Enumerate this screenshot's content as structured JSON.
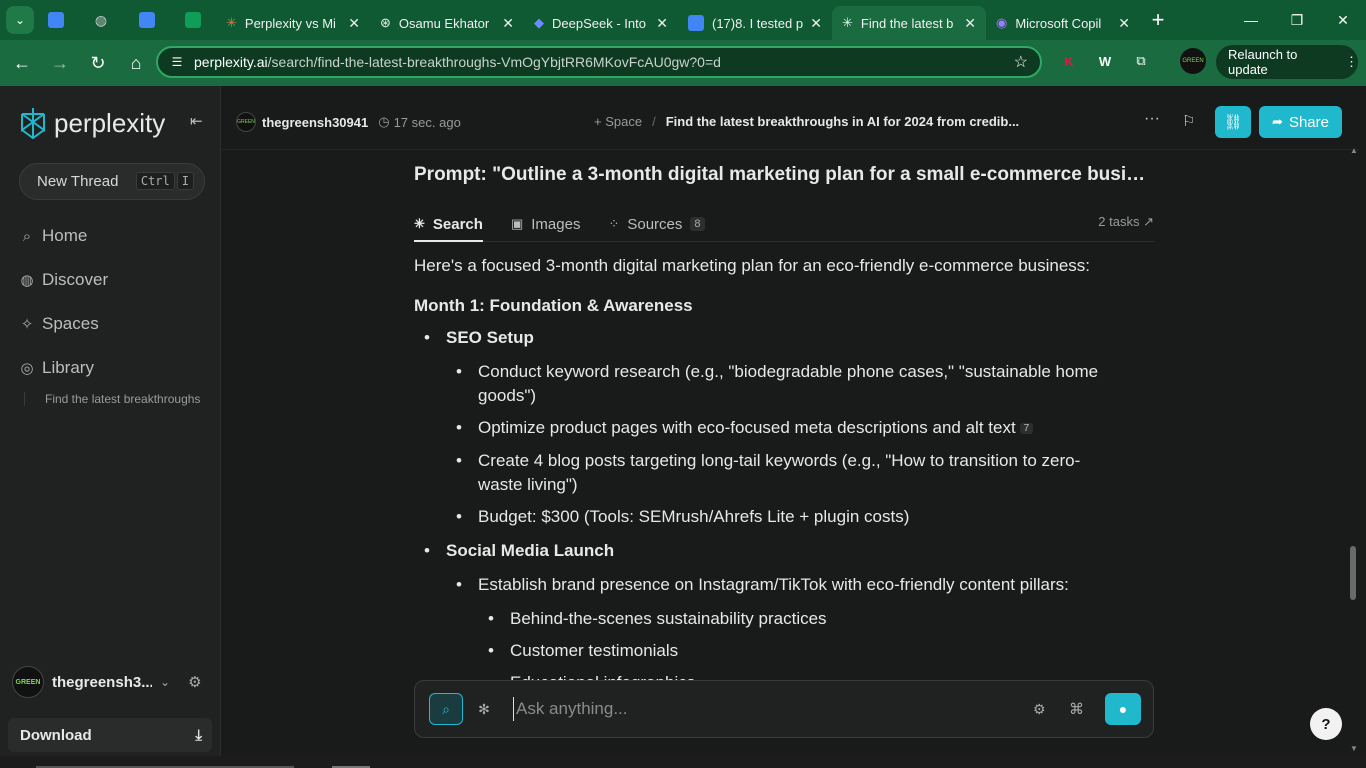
{
  "browser": {
    "tabs": [
      {
        "title": "",
        "favicon": "google-docs-icon",
        "color": "#4285f4"
      },
      {
        "title": "",
        "favicon": "globe-icon",
        "color": "#9aa0a6"
      },
      {
        "title": "",
        "favicon": "google-docs-icon",
        "color": "#4285f4"
      },
      {
        "title": "",
        "favicon": "google-sheets-icon",
        "color": "#0f9d58"
      },
      {
        "title": "Perplexity vs Mi",
        "favicon": "perplexity-icon",
        "color": "#e8743b"
      },
      {
        "title": "Osamu Ekhator",
        "favicon": "openai-icon",
        "color": "#ffffff"
      },
      {
        "title": "DeepSeek - Into",
        "favicon": "deepseek-icon",
        "color": "#4d6bfe"
      },
      {
        "title": "(17)8. I tested p",
        "favicon": "google-docs-icon",
        "color": "#4285f4"
      },
      {
        "title": "Find the latest b",
        "favicon": "perplexity-icon",
        "color": "#ffffff",
        "active": true
      },
      {
        "title": "Microsoft Copil",
        "favicon": "copilot-icon",
        "color": "#7b5cf5"
      }
    ],
    "url_domain": "perplexity.ai",
    "url_path": "/search/find-the-latest-breakthroughs-VmOgYbjtRR6MKovFcAU0gw?0=d",
    "relaunch_label": "Relaunch to update",
    "extensions": [
      "K",
      "W"
    ]
  },
  "sidebar": {
    "logo_text": "perplexity",
    "new_thread_label": "New Thread",
    "shortcut": [
      "Ctrl",
      "I"
    ],
    "nav": [
      {
        "label": "Home",
        "icon": "search-icon"
      },
      {
        "label": "Discover",
        "icon": "globe-icon"
      },
      {
        "label": "Spaces",
        "icon": "spaces-icon"
      },
      {
        "label": "Library",
        "icon": "library-icon"
      }
    ],
    "library_item": "Find the latest breakthroughs",
    "user_name": "thegreensh3...",
    "avatar_text": "GREEN",
    "download_label": "Download"
  },
  "topbar": {
    "user": "thegreensh30941",
    "time": "17 sec. ago",
    "space_label": "+ Space",
    "thread_title": "Find the latest breakthroughs in AI for 2024 from credib...",
    "share_label": "Share"
  },
  "thread": {
    "question": "Prompt: \"Outline a 3-month digital marketing plan for a small e-commerce business...",
    "tabs": [
      {
        "label": "Search",
        "icon": "perplexity-icon"
      },
      {
        "label": "Images",
        "icon": "image-icon"
      },
      {
        "label": "Sources",
        "icon": "sources-icon",
        "count": "8"
      }
    ],
    "tasks_label": "2 tasks ↗",
    "intro": "Here's a focused 3-month digital marketing plan for an eco-friendly e-commerce business:",
    "month1_heading": "Month 1: Foundation & Awareness",
    "sections": [
      {
        "heading": "SEO Setup",
        "items": [
          "Conduct keyword research (e.g., \"biodegradable phone cases,\" \"sustainable home goods\")",
          "Optimize product pages with eco-focused meta descriptions and alt text",
          "Create 4 blog posts targeting long-tail keywords (e.g., \"How to transition to zero-waste living\")",
          "Budget: $300 (Tools: SEMrush/Ahrefs Lite + plugin costs)"
        ],
        "citation": "7"
      },
      {
        "heading": "Social Media Launch",
        "item": "Establish brand presence on Instagram/TikTok with eco-friendly content pillars:",
        "subitems": [
          "Behind-the-scenes sustainability practices",
          "Customer testimonials",
          "Educational infographics"
        ]
      }
    ]
  },
  "ask": {
    "placeholder": "Ask anything..."
  },
  "help_label": "?"
}
